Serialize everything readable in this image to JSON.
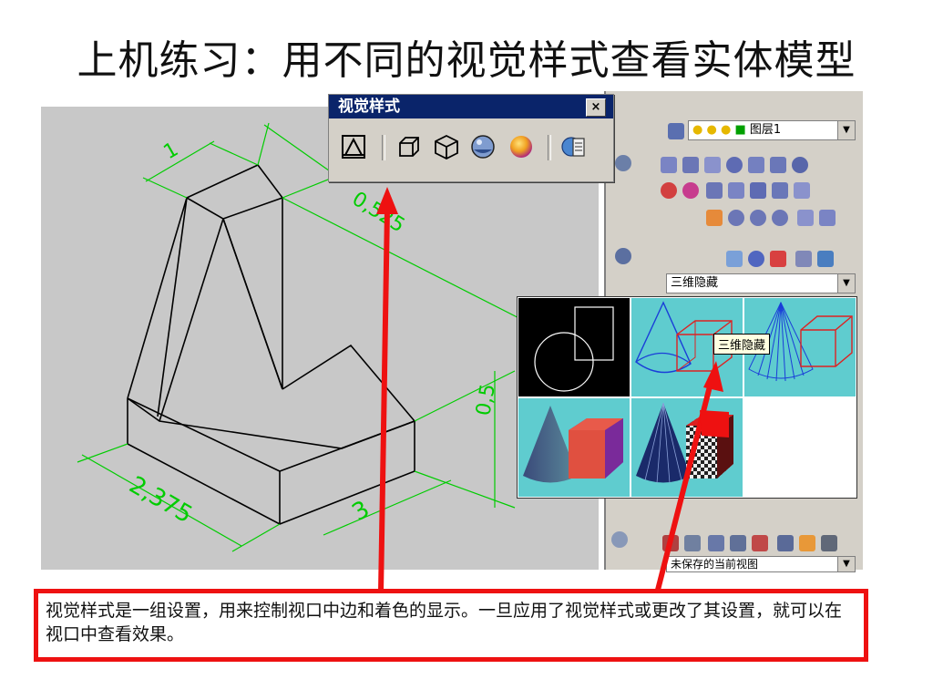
{
  "title": "上机练习：用不同的视觉样式查看实体模型",
  "toolbar": {
    "title": "视觉样式",
    "close_label": "×",
    "buttons": [
      {
        "name": "2d-wireframe-icon"
      },
      {
        "name": "3d-wireframe-icon"
      },
      {
        "name": "3d-hidden-icon"
      },
      {
        "name": "realistic-icon"
      },
      {
        "name": "conceptual-icon"
      },
      {
        "name": "visual-styles-manager-icon"
      }
    ]
  },
  "right_panel": {
    "layer_label": "图层1",
    "visual_style_selected": "三维隐藏",
    "view_selected": "未保存的当前视图"
  },
  "gallery": {
    "tooltip": "三维隐藏",
    "accent": "#5fcccf"
  },
  "drawing": {
    "dim_top": "1",
    "dim_diag": "0,525",
    "dim_right": "0,5",
    "dim_left": "2,375",
    "dim_bottom": "3"
  },
  "callout": {
    "text": "视觉样式是一组设置，用来控制视口中边和着色的显示。一旦应用了视觉样式或更改了其设置，就可以在视口中查看效果。"
  },
  "colors": {
    "callout_border": "#ee1111",
    "dimension": "#00cc00",
    "titlebar": "#0a246a"
  }
}
